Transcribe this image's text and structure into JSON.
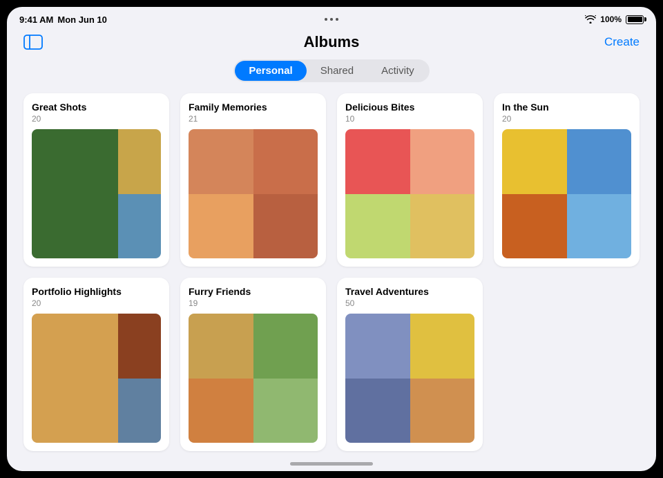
{
  "statusBar": {
    "time": "9:41 AM",
    "day": "Mon Jun 10",
    "battery": "100%"
  },
  "header": {
    "title": "Albums",
    "createLabel": "Create",
    "sidebarLabel": "Sidebar"
  },
  "tabs": {
    "personal": "Personal",
    "shared": "Shared",
    "activity": "Activity",
    "activeTab": "personal"
  },
  "albums": [
    {
      "id": "great-shots",
      "title": "Great Shots",
      "count": "20",
      "layout": "3"
    },
    {
      "id": "family-memories",
      "title": "Family Memories",
      "count": "21",
      "layout": "4"
    },
    {
      "id": "delicious-bites",
      "title": "Delicious Bites",
      "count": "10",
      "layout": "4"
    },
    {
      "id": "in-the-sun",
      "title": "In the Sun",
      "count": "20",
      "layout": "4"
    },
    {
      "id": "portfolio-highlights",
      "title": "Portfolio Highlights",
      "count": "20",
      "layout": "3"
    },
    {
      "id": "furry-friends",
      "title": "Furry Friends",
      "count": "19",
      "layout": "4"
    },
    {
      "id": "travel-adventures",
      "title": "Travel Adventures",
      "count": "50",
      "layout": "4"
    }
  ]
}
